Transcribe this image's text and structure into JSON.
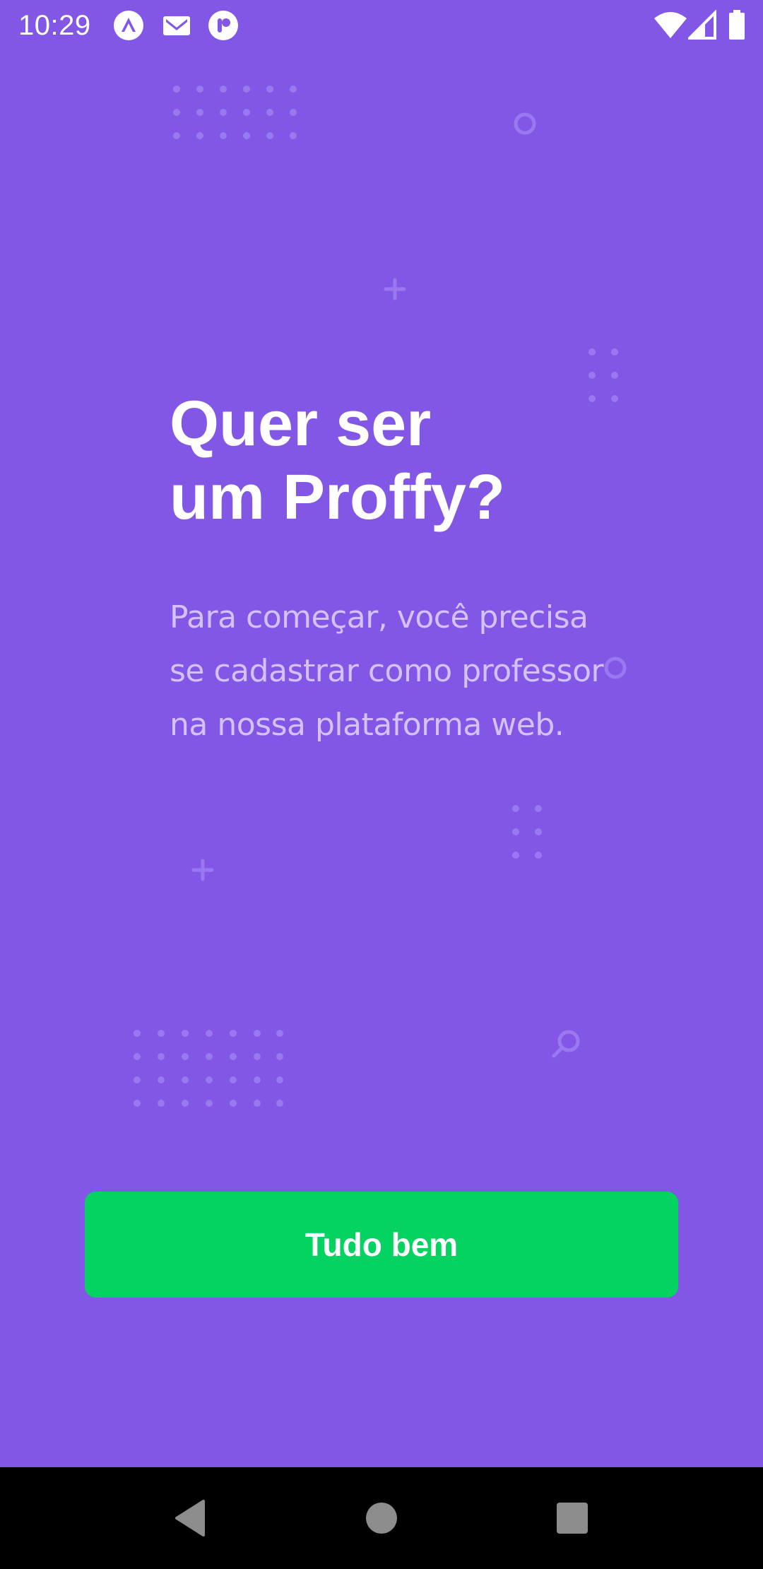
{
  "status_bar": {
    "time": "10:29",
    "left_icons": [
      "expo-app-icon",
      "gmail-icon",
      "notification-app-icon"
    ],
    "right_icons": [
      "wifi-icon",
      "signal-icon",
      "battery-icon"
    ]
  },
  "onboarding": {
    "title_line1": "Quer ser",
    "title_line2": "um Proffy?",
    "description": "Para começar, você precisa se cadastrar como professor na nossa plataforma web.",
    "button_label": "Tudo bem"
  },
  "nav_bar": {
    "buttons": [
      "back-icon",
      "home-icon",
      "recents-icon"
    ]
  },
  "colors": {
    "background": "#8257E5",
    "button": "#04D361",
    "title": "#FFFFFF",
    "description": "#D4C2FF",
    "decoration": "#9A79F0",
    "nav_bar": "#000000"
  }
}
